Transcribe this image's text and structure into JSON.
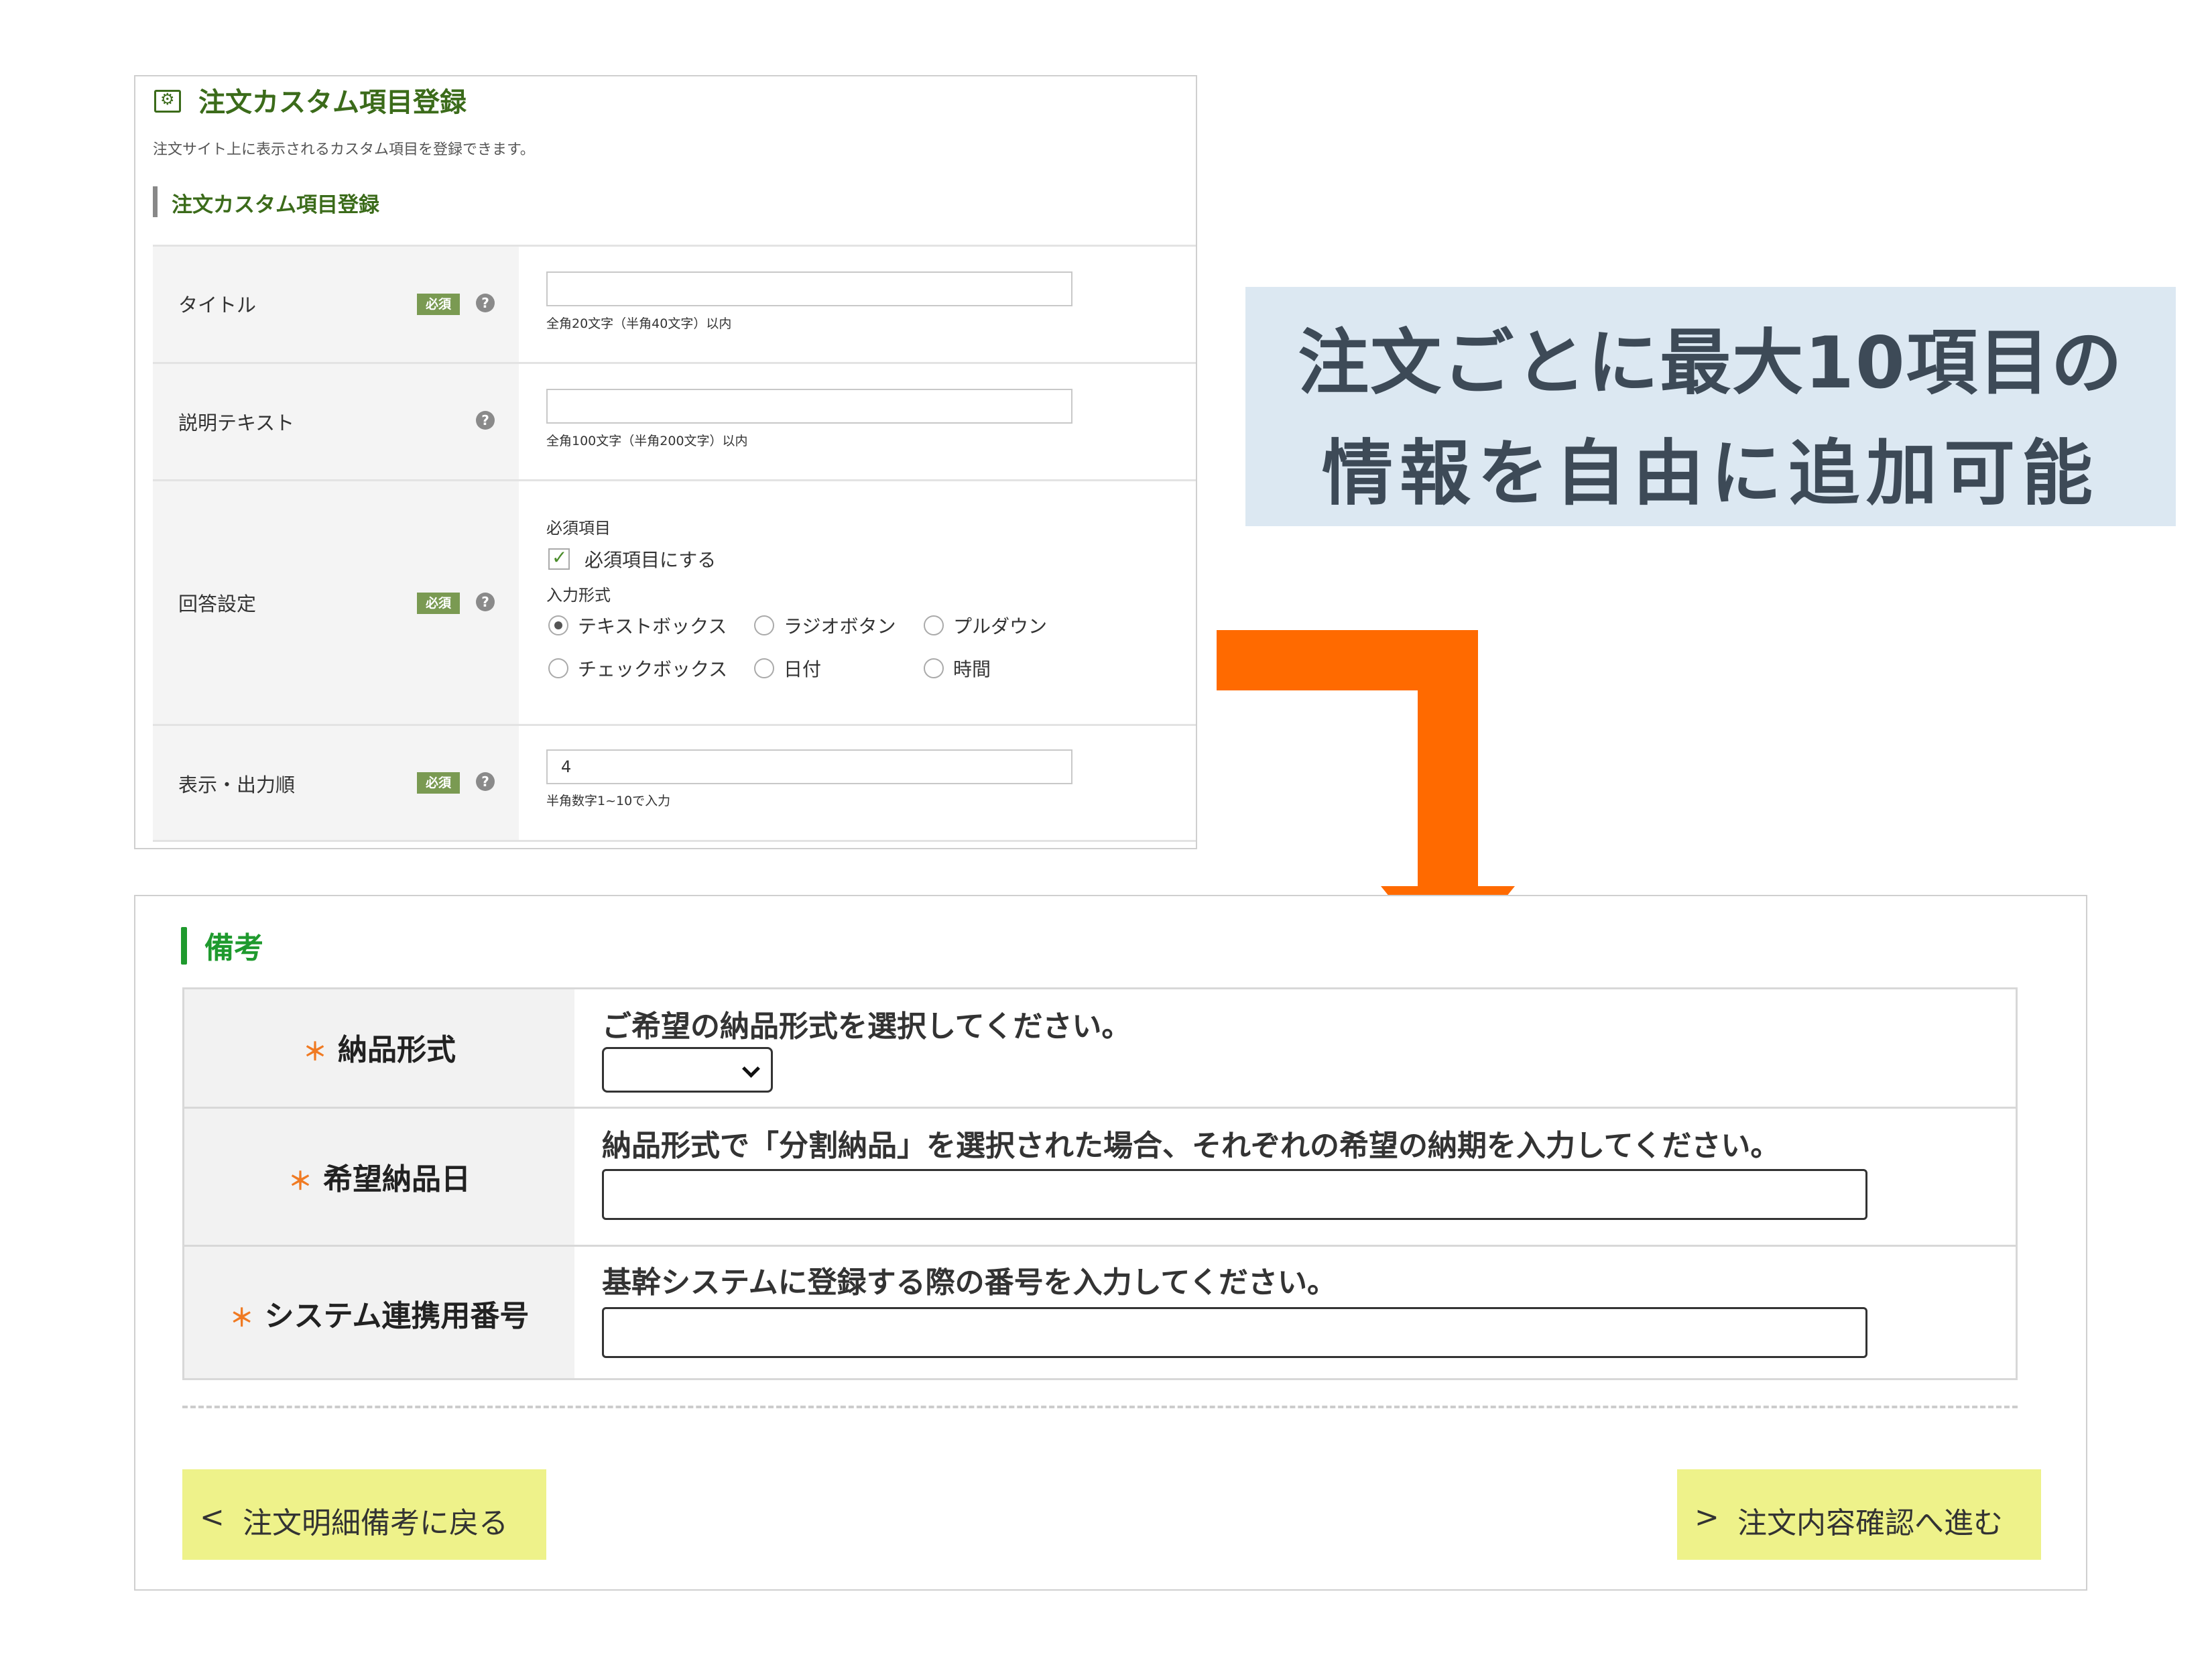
{
  "admin": {
    "title": "注文カスタム項目登録",
    "description": "注文サイト上に表示されるカスタム項目を登録できます。",
    "section_title": "注文カスタム項目登録",
    "required_badge": "必須",
    "help_glyph": "?",
    "fields": {
      "title": {
        "label": "タイトル",
        "value": "",
        "hint": "全角20文字（半角40文字）以内"
      },
      "description_text": {
        "label": "説明テキスト",
        "value": "",
        "hint": "全角100文字（半角200文字）以内"
      },
      "answer_settings": {
        "label": "回答設定",
        "required_group_label": "必須項目",
        "required_checkbox_label": "必須項目にする",
        "required_checked": true,
        "input_type_label": "入力形式",
        "options": [
          "テキストボックス",
          "ラジオボタン",
          "プルダウン",
          "チェックボックス",
          "日付",
          "時間"
        ],
        "selected_option": "テキストボックス"
      },
      "display_order": {
        "label": "表示・出力順",
        "value": "4",
        "hint": "半角数字1~10で入力"
      }
    }
  },
  "callout": {
    "line1": "注文ごとに最大10項目の",
    "line2": "情報を自由に追加可能",
    "background": "#dce8f2"
  },
  "arrow": {
    "color": "#ff6a00"
  },
  "order_form": {
    "section_title": "備考",
    "accent_color": "#1f9a2e",
    "required_mark": "＊",
    "rows": [
      {
        "label": "納品形式",
        "description": "ご希望の納品形式を選択してください。",
        "control": "select",
        "value": ""
      },
      {
        "label": "希望納品日",
        "description": "納品形式で「分割納品」を選択された場合、それぞれの希望の納期を入力してください。",
        "control": "text",
        "value": ""
      },
      {
        "label": "システム連携用番号",
        "description": "基幹システムに登録する際の番号を入力してください。",
        "control": "text",
        "value": ""
      }
    ],
    "back_button": "注文明細備考に戻る",
    "next_button": "注文内容確認へ進む",
    "button_color": "#eef28a"
  }
}
